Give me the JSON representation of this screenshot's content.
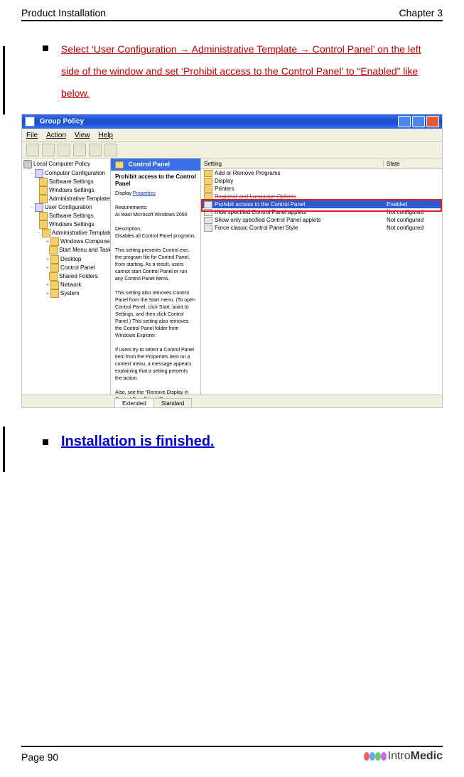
{
  "header": {
    "left": "Product Installation",
    "right": "Chapter 3"
  },
  "instruction1": "Select ‘User Configuration → Administrative Template → Control Panel’ on the left side of the window and set ‘Prohibit access to the Control Panel’ to “Enabled” like below.",
  "instruction2": "Installation is finished.",
  "footer": {
    "page": "Page 90",
    "logo_text": "IntroMedic"
  },
  "gp": {
    "title": "Group Policy",
    "menu": {
      "file": "File",
      "action": "Action",
      "view": "View",
      "help": "Help"
    },
    "tree": {
      "root": "Local Computer Policy",
      "compcfg": "Computer Configuration",
      "cc1": "Software Settings",
      "cc2": "Windows Settings",
      "cc3": "Administrative Templates",
      "usercfg": "User Configuration",
      "uc1": "Software Settings",
      "uc2": "Windows Settings",
      "uc3": "Administrative Templates",
      "at1": "Windows Components",
      "at2": "Start Menu and Taskbar",
      "at3": "Desktop",
      "at4": "Control Panel",
      "at5": "Shared Folders",
      "at6": "Network",
      "at7": "System"
    },
    "explain": {
      "header": "Control Panel",
      "policy": "Prohibit access to the Control Panel",
      "display": "Display",
      "properties": "Properties",
      "req_label": "Requirements:",
      "req_text": "At least Microsoft Windows 2000",
      "desc_label": "Description:",
      "desc_text": "Disables all Control Panel programs.",
      "p2": "This setting prevents Control.exe, the program file for Control Panel, from starting. As a result, users cannot start Control Panel or run any Control Panel items.",
      "p3": "This setting also removes Control Panel from the Start menu. (To open Control Panel, click Start, point to Settings, and then click Control Panel.) This setting also removes the Control Panel folder from Windows Explorer.",
      "p4": "If users try to select a Control Panel item from the Properties item on a context menu, a message appears explaining that a setting prevents the action.",
      "p5": "Also, see the “Remove Display in Control Panel” and “Remove programs on Settings menu” settings."
    },
    "cols": {
      "setting": "Setting",
      "state": "State"
    },
    "tabs": {
      "extended": "Extended",
      "standard": "Standard"
    },
    "rows": [
      {
        "icon": "folder",
        "name": "Add or Remove Programs",
        "state": ""
      },
      {
        "icon": "folder",
        "name": "Display",
        "state": ""
      },
      {
        "icon": "folder",
        "name": "Printers",
        "state": ""
      },
      {
        "icon": "folder",
        "name": "Regional and Language Options",
        "state": "",
        "struck": true
      },
      {
        "icon": "note",
        "name": "Prohibit access to the Control Panel",
        "state": "Enabled",
        "selected": true
      },
      {
        "icon": "note",
        "name": "Hide specified Control Panel applets",
        "state": "Not configured"
      },
      {
        "icon": "note",
        "name": "Show only specified Control Panel applets",
        "state": "Not configured"
      },
      {
        "icon": "note",
        "name": "Force classic Control Panel Style",
        "state": "Not configured"
      }
    ]
  }
}
